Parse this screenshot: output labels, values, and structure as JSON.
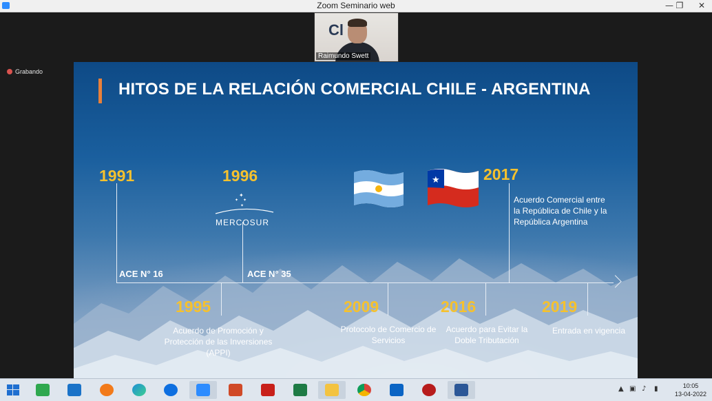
{
  "window": {
    "title": "Zoom Seminario web",
    "min_label": "—",
    "max_label": "❐",
    "close_label": "✕"
  },
  "video": {
    "participant_name": "Raimundo Swett",
    "logo_text": "Cl"
  },
  "recording": {
    "label": "Grabando"
  },
  "slide": {
    "title": "HITOS DE LA RELACIÓN COMERCIAL CHILE - ARGENTINA",
    "mercosur_label": "MERCOSUR",
    "milestones_top": [
      {
        "year": "1991",
        "ace": "ACE N° 16"
      },
      {
        "year": "1996",
        "ace": "ACE N° 35"
      },
      {
        "year": "2017",
        "desc": [
          "Acuerdo Comercial entre",
          "la República de Chile y la",
          "República Argentina"
        ]
      }
    ],
    "milestones_bottom": [
      {
        "year": "1995",
        "desc": [
          "Acuerdo de Promoción y",
          "Protección de las Inversiones",
          "(APPI)"
        ]
      },
      {
        "year": "2009",
        "desc": [
          "Protocolo de Comercio de",
          "Servicios"
        ]
      },
      {
        "year": "2016",
        "desc": [
          "Acuerdo para Evitar la",
          "Doble Tributación"
        ]
      },
      {
        "year": "2019",
        "desc": [
          "Entrada en vigencia"
        ]
      }
    ],
    "colors": {
      "year": "#f5c12e",
      "accent": "#e8803a"
    }
  },
  "taskbar": {
    "apps": [
      "windows-start",
      "store",
      "settings",
      "avast",
      "edge",
      "teamviewer",
      "zoom",
      "powerpoint",
      "acrobat",
      "excel",
      "file-explorer",
      "chrome",
      "outlook",
      "power",
      "word"
    ],
    "time": "10:05",
    "date": "13-04-2022"
  }
}
